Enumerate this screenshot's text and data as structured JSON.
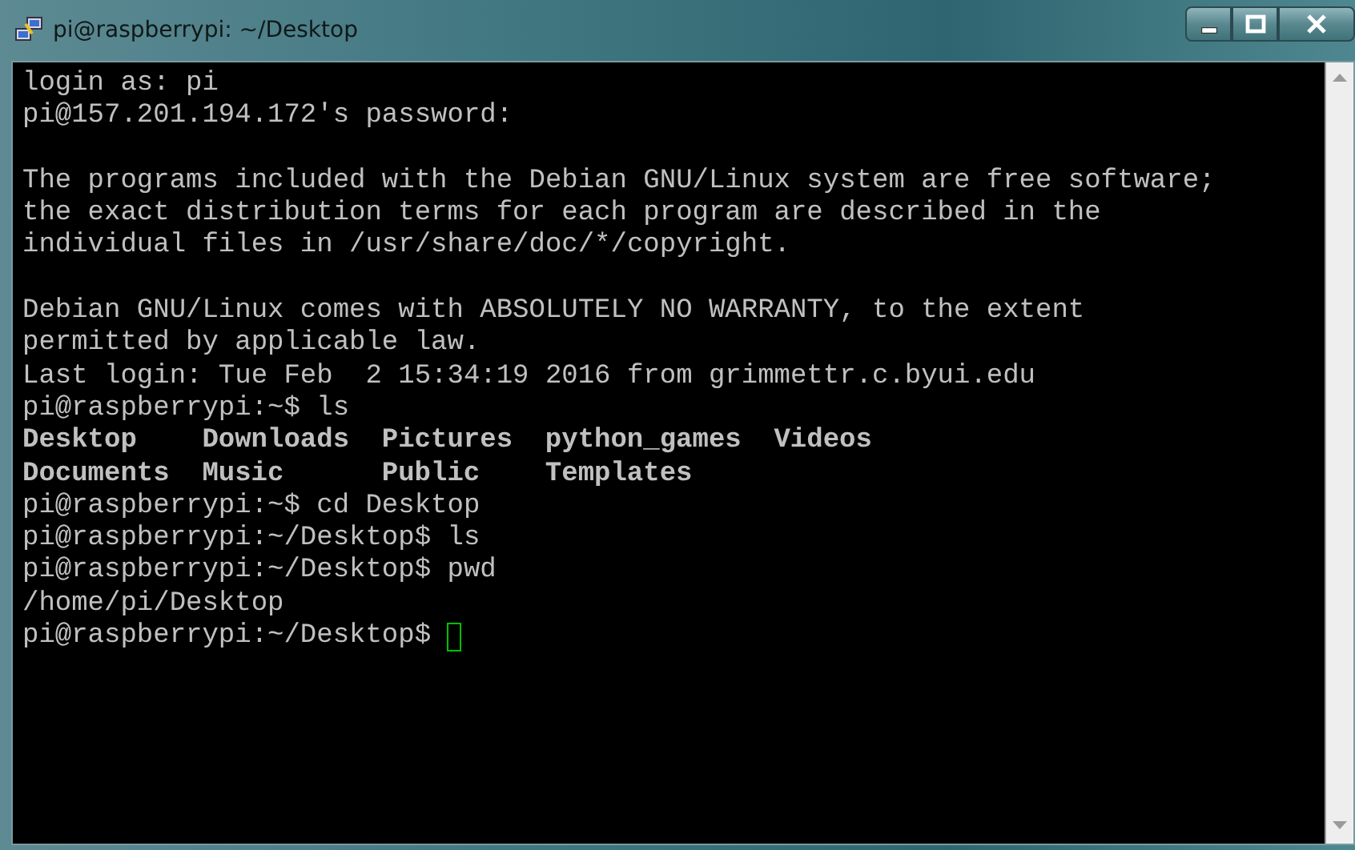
{
  "window": {
    "title": "pi@raspberrypi: ~/Desktop"
  },
  "terminal": {
    "lines": [
      {
        "kind": "text",
        "text": "login as: pi"
      },
      {
        "kind": "text",
        "text": "pi@157.201.194.172's password:"
      },
      {
        "kind": "blank"
      },
      {
        "kind": "text",
        "text": "The programs included with the Debian GNU/Linux system are free software;"
      },
      {
        "kind": "text",
        "text": "the exact distribution terms for each program are described in the"
      },
      {
        "kind": "text",
        "text": "individual files in /usr/share/doc/*/copyright."
      },
      {
        "kind": "blank"
      },
      {
        "kind": "text",
        "text": "Debian GNU/Linux comes with ABSOLUTELY NO WARRANTY, to the extent"
      },
      {
        "kind": "text",
        "text": "permitted by applicable law."
      },
      {
        "kind": "text",
        "text": "Last login: Tue Feb  2 15:34:19 2016 from grimmettr.c.byui.edu"
      },
      {
        "kind": "text",
        "text": "pi@raspberrypi:~$ ls"
      },
      {
        "kind": "listing",
        "entries": [
          "Desktop",
          "Downloads",
          "Pictures",
          "python_games",
          "Videos"
        ]
      },
      {
        "kind": "listing",
        "entries": [
          "Documents",
          "Music",
          "Public",
          "Templates"
        ]
      },
      {
        "kind": "text",
        "text": "pi@raspberrypi:~$ cd Desktop"
      },
      {
        "kind": "text",
        "text": "pi@raspberrypi:~/Desktop$ ls"
      },
      {
        "kind": "text",
        "text": "pi@raspberrypi:~/Desktop$ pwd"
      },
      {
        "kind": "text",
        "text": "/home/pi/Desktop"
      },
      {
        "kind": "text",
        "text": "pi@raspberrypi:~/Desktop$ ",
        "cursor": true
      }
    ]
  }
}
